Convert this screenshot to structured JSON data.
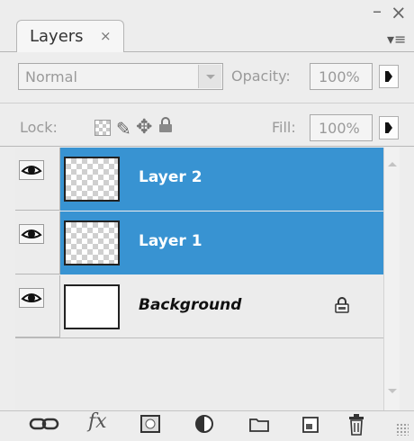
{
  "panel": {
    "tab_label": "Layers",
    "tab_close_glyph": "×",
    "minimize_glyph": "–",
    "close_glyph": "×",
    "menu_glyph": "▾≡"
  },
  "blend": {
    "mode": "Normal",
    "opacity_label": "Opacity:",
    "opacity_value": "100%"
  },
  "lock": {
    "label": "Lock:",
    "fill_label": "Fill:",
    "fill_value": "100%"
  },
  "layers": [
    {
      "name": "Layer 2",
      "selected": true,
      "visible": true,
      "thumbnail": "transparent"
    },
    {
      "name": "Layer 1",
      "selected": true,
      "visible": true,
      "thumbnail": "transparent"
    },
    {
      "name": "Background",
      "selected": false,
      "visible": true,
      "thumbnail": "white",
      "locked": true
    }
  ],
  "toolbar": {
    "buttons": [
      "link-layers-icon",
      "fx-icon",
      "layer-mask-icon",
      "adjustment-layer-icon",
      "new-group-icon",
      "new-layer-icon",
      "trash-icon"
    ],
    "fx_label": "fx"
  },
  "colors": {
    "selection": "#3893d2",
    "panel": "#ededed"
  }
}
